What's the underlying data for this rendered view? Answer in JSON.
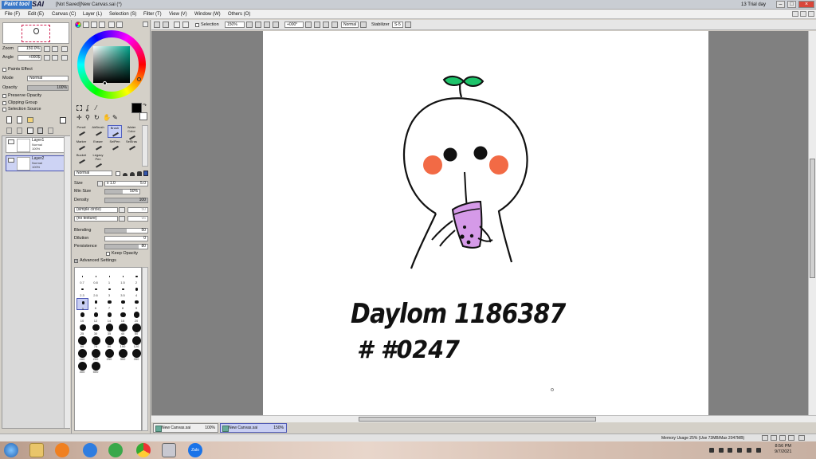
{
  "window": {
    "logo_text": "Paint tool",
    "logo_text2": "SAI",
    "title": "[Not Saved]New Canvas.sai (*)",
    "trial": "13 Trial day",
    "buttons": [
      "minimize",
      "maximize",
      "close"
    ]
  },
  "menu": [
    {
      "label": "File (F)"
    },
    {
      "label": "Edit (E)"
    },
    {
      "label": "Canvas (C)"
    },
    {
      "label": "Layer (L)"
    },
    {
      "label": "Selection (S)"
    },
    {
      "label": "Filter (T)"
    },
    {
      "label": "View (V)"
    },
    {
      "label": "Window (W)"
    },
    {
      "label": "Others (O)"
    }
  ],
  "navigator": {
    "zoom_label": "Zoom",
    "zoom_value": "150.0%",
    "angle_label": "Angle",
    "angle_value": "+000$"
  },
  "layer_props": {
    "paints_effect": "Paints Effect",
    "mode_label": "Mode",
    "mode_value": "Normal",
    "opacity_label": "Opacity",
    "opacity_value": "100%",
    "preserve_opacity": "Preserve Opacity",
    "clipping_group": "Clipping Group",
    "selection_source": "Selection Source"
  },
  "layers": [
    {
      "name": "Layer1",
      "mode": "Normal",
      "opacity": "100%",
      "selected": false
    },
    {
      "name": "Layer2",
      "mode": "Normal",
      "opacity": "100%",
      "selected": true
    }
  ],
  "tools": {
    "row1": [
      {
        "name": "Pencil"
      },
      {
        "name": "AirBrush"
      },
      {
        "name": "Brush",
        "selected": true
      },
      {
        "name": "Water Color"
      }
    ],
    "row2": [
      {
        "name": "Marker"
      },
      {
        "name": "Eraser"
      },
      {
        "name": "SelPen"
      },
      {
        "name": "SelEras"
      }
    ],
    "row3": [
      {
        "name": "Bucket"
      },
      {
        "name": "Legacy Pen"
      }
    ]
  },
  "brush_settings": {
    "blend_mode": "Normal",
    "size_label": "Size",
    "size_mult": "x 1.0",
    "size_value": "5.0",
    "min_size_label": "Min Size",
    "min_size_value": "50%",
    "min_size_fraction": 0.5,
    "density_label": "Density",
    "density_value": "100",
    "texture1": "(simple circle)",
    "texture1_value": "50",
    "texture2": "(no texture)",
    "texture2_value": "95",
    "blending_label": "Blending",
    "blending_value": "50",
    "blending_fraction": 0.5,
    "dilution_label": "Dilution",
    "dilution_value": "0",
    "persistence_label": "Persistence",
    "persistence_value": "80",
    "persistence_fraction": 0.8,
    "keep_opacity": "Keep Opacity",
    "advanced": "Advanced Settings"
  },
  "brush_sizes": [
    "0.7",
    "0.8",
    "1",
    "1.5",
    "2",
    "2.3",
    "2.6",
    "3",
    "3.5",
    "4",
    "5",
    "6",
    "7",
    "8",
    "9",
    "10",
    "12",
    "14",
    "16",
    "20",
    "25",
    "30",
    "35",
    "40",
    "50",
    "60",
    "70",
    "80",
    "100",
    "120",
    "160",
    "200",
    "250",
    "300",
    "350",
    "400",
    "500"
  ],
  "canvas_toolbar": {
    "selection_label": "Selection",
    "zoom": "150%",
    "angle": "+000°",
    "blend": "Normal",
    "stabilizer_label": "Stabilizer",
    "stabilizer_value": "S-5"
  },
  "drawing_text": {
    "line1": "Daylom 1186387",
    "line2": "# #0247"
  },
  "doc_tabs": [
    {
      "name": "New Canvas.sai",
      "zoom": "100%",
      "selected": false
    },
    {
      "name": "New Canvas.sai",
      "zoom": "150%",
      "selected": true
    }
  ],
  "status": {
    "memory": "Memory Usage 25% (Use 73MB/Max 2047MB)"
  },
  "taskbar": {
    "time": "8:56 PM",
    "date": "9/7/2021",
    "icons": [
      "start-orb-icon",
      "folder-icon",
      "media-player-icon",
      "ie-icon",
      "green-app-icon",
      "chrome-icon",
      "paint-tool-sai-icon",
      "zalo-icon"
    ]
  },
  "colors": {
    "accent_selected": "#c9cff3",
    "leaf_green": "#1ec36a",
    "blush_orange": "#f26a45",
    "cup_purple": "#d59ae8"
  }
}
